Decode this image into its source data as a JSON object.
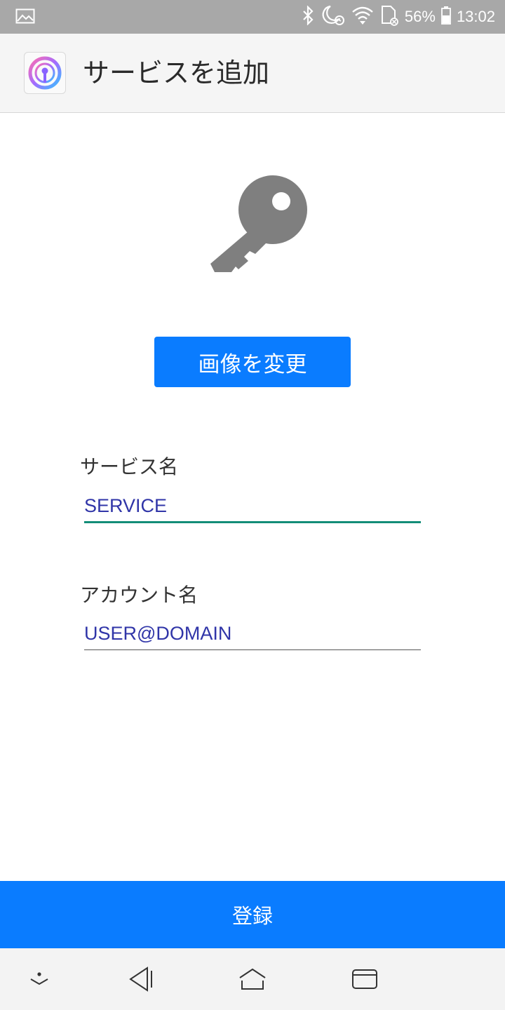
{
  "status_bar": {
    "battery_percent": "56%",
    "time": "13:02",
    "icons": [
      "gallery-icon",
      "bluetooth-icon",
      "dnd-alarm-icon",
      "wifi-icon",
      "sd-card-icon",
      "battery-icon"
    ]
  },
  "app_bar": {
    "title": "サービスを追加",
    "logo_icon": "app-logo-icon"
  },
  "main": {
    "illustration_icon": "key-icon",
    "change_image_label": "画像を変更",
    "service_name": {
      "label": "サービス名",
      "value": "SERVICE"
    },
    "account_name": {
      "label": "アカウント名",
      "value": "USER@DOMAIN"
    }
  },
  "register_label": "登録",
  "nav_bar": {
    "icons": [
      "hide-nav-icon",
      "back-icon",
      "home-icon",
      "recents-icon"
    ]
  },
  "colors": {
    "accent": "#0a7cff",
    "active_underline": "#138d78",
    "field_text": "#3035a8",
    "status_bar": "#a8a8a8"
  }
}
